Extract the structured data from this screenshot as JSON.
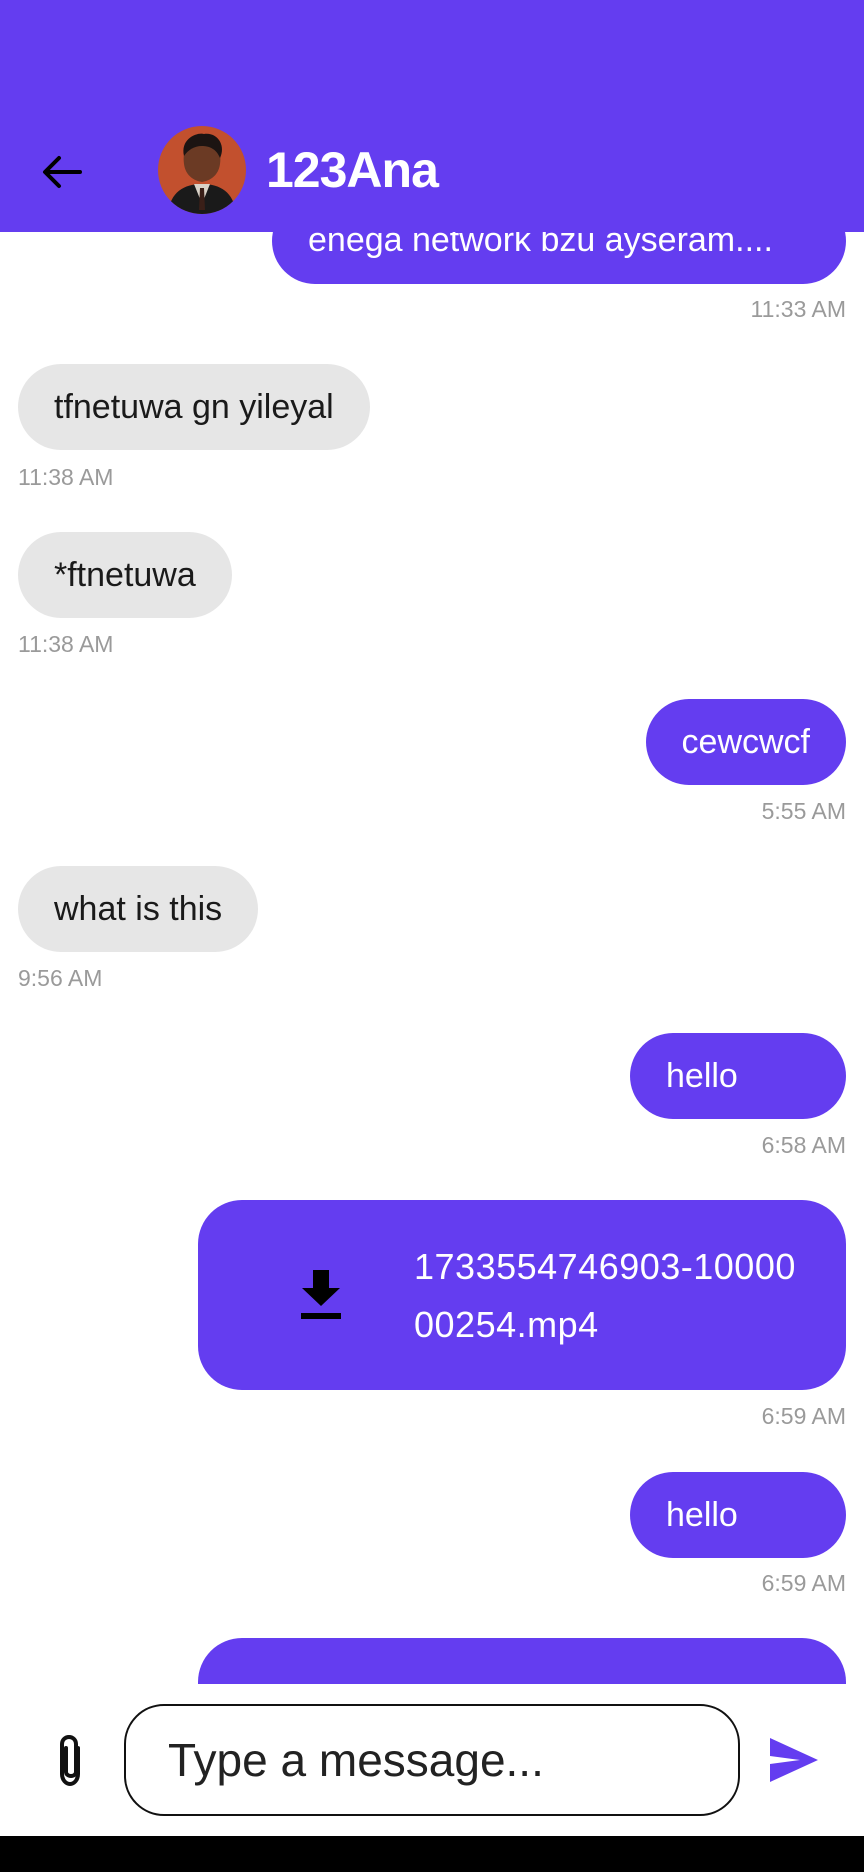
{
  "app": {
    "accent_color": "#643df0",
    "incoming_bubble_color": "#e6e6e6"
  },
  "header": {
    "back_icon": "arrow-left-icon",
    "contact_name": "123Ana",
    "avatar": "contact-avatar"
  },
  "messages": [
    {
      "direction": "out",
      "text": "enega network bzu ayseram....",
      "time": "11:33 AM"
    },
    {
      "direction": "in",
      "text": "tfnetuwa gn yileyal",
      "time": "11:38 AM"
    },
    {
      "direction": "in",
      "text": "*ftnetuwa",
      "time": "11:38 AM"
    },
    {
      "direction": "out",
      "text": "cewcwcf",
      "time": "5:55 AM"
    },
    {
      "direction": "in",
      "text": "what is this",
      "time": "9:56 AM"
    },
    {
      "direction": "out",
      "text": "hello",
      "time": "6:58 AM"
    },
    {
      "direction": "out",
      "type": "file",
      "icon": "download-icon",
      "file_name": "1733554746903-1000000254.mp4",
      "time": "6:59 AM"
    },
    {
      "direction": "out",
      "text": "hello",
      "time": "6:59 AM"
    }
  ],
  "composer": {
    "attach_icon": "paperclip-icon",
    "placeholder": "Type a message...",
    "send_icon": "send-icon"
  }
}
